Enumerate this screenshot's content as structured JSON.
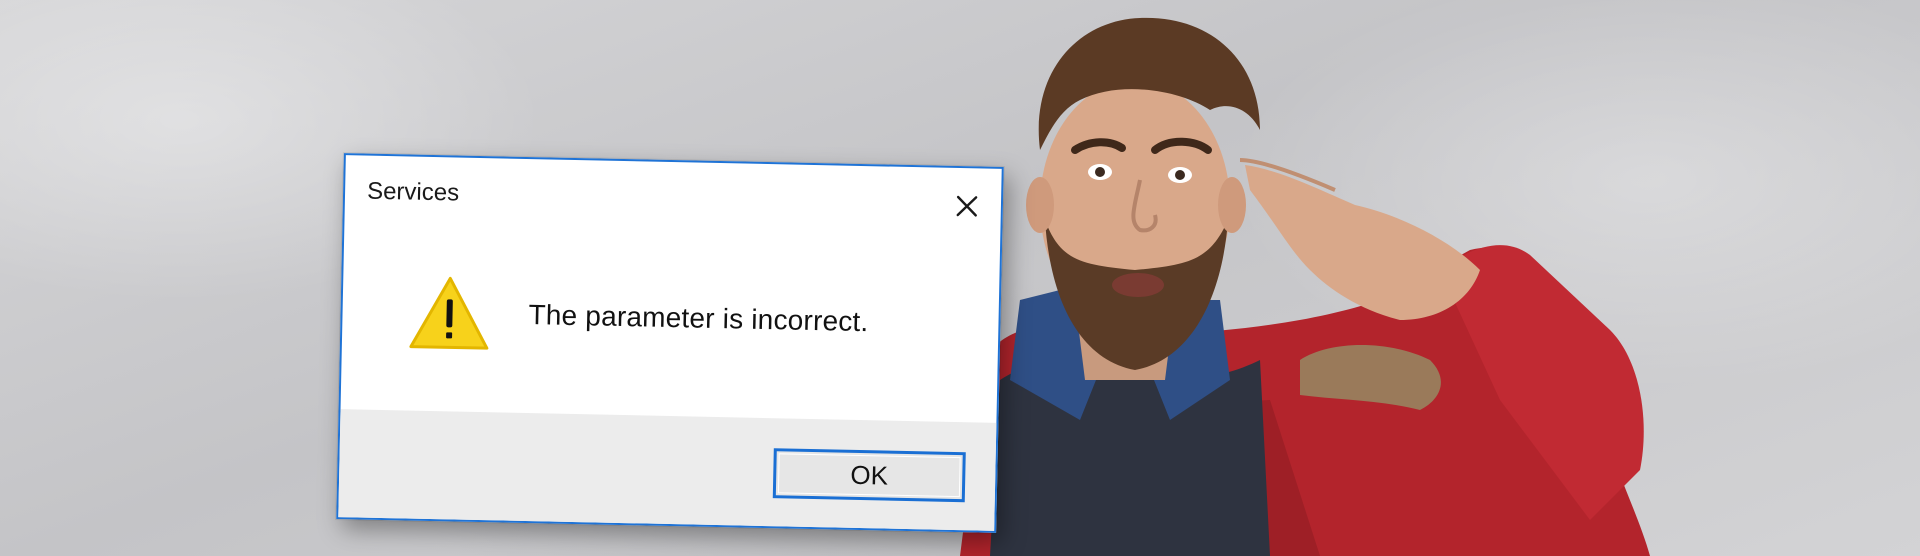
{
  "dialog": {
    "title": "Services",
    "message": "The parameter is incorrect.",
    "ok_label": "OK",
    "icon": "warning-icon",
    "close_icon": "close-icon"
  },
  "colors": {
    "accent": "#1f73d6",
    "warning": "#f7d21b",
    "jacket": "#b3242c",
    "background": "#cfcfd1"
  }
}
